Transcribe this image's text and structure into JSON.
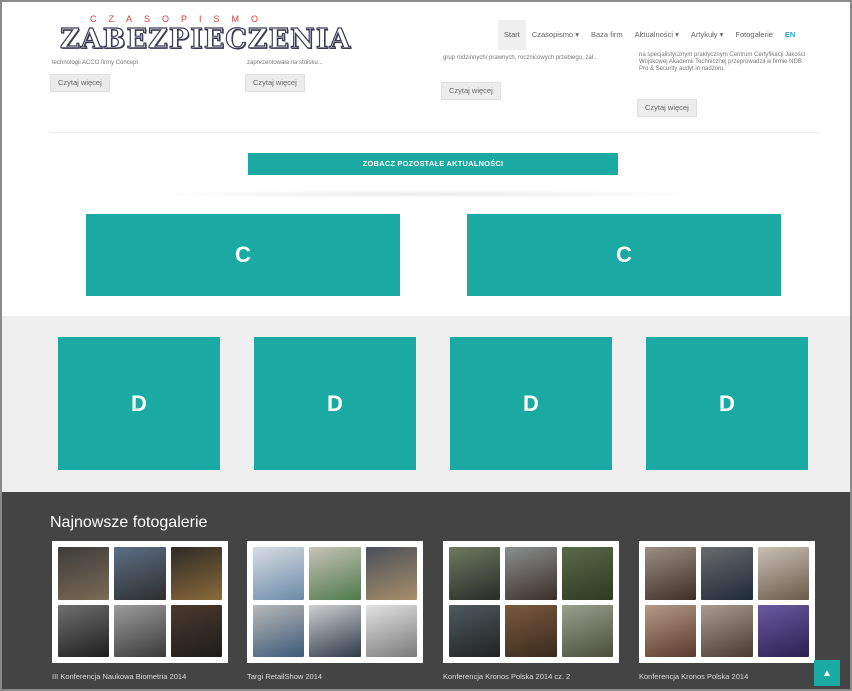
{
  "header": {
    "logo_top": "CZASOPISMO",
    "logo_main": "ZABEZPIECZENIA",
    "nav": [
      {
        "label": "Start"
      },
      {
        "label": "Czasopismo ▾"
      },
      {
        "label": "Baza firm"
      },
      {
        "label": "Aktualności ▾"
      },
      {
        "label": "Artykuły ▾"
      },
      {
        "label": "Fotogalerie"
      },
      {
        "label": "EN"
      }
    ]
  },
  "teasers": [
    {
      "text": "technologii ACCO firmy Concept",
      "button": "Czytaj więcej"
    },
    {
      "text": "zaprezentowała na stoisku...",
      "button": "Czytaj więcej"
    },
    {
      "text": "grup rodzinnych/ prawnych, rocznicowych przebiegu, zał...",
      "button": "Czytaj więcej"
    },
    {
      "text": "na specjalistycznym praktycznym Centrum Certyfikacji Jakości Wojskowej Akademii Technicznej przeprowadził w firmie NDB Pro & Security audyt in nadzoru.",
      "button": "Czytaj więcej"
    }
  ],
  "see_all_button": "ZOBACZ POZOSTAŁE AKTUALNOŚCI",
  "c_blocks": [
    "C",
    "C"
  ],
  "d_blocks": [
    "D",
    "D",
    "D",
    "D"
  ],
  "galleries": {
    "title": "Najnowsze fotogalerie",
    "items": [
      {
        "label": "III Konferencja Naukowa Biometria 2014"
      },
      {
        "label": "Targi RetailShow 2014"
      },
      {
        "label": "Konferencja Kronos Polska 2014 cz. 2"
      },
      {
        "label": "Konferencja Kronos Polska 2014"
      }
    ]
  },
  "scroll_top_icon": "chevron-up-icon",
  "colors": {
    "accent": "#1ba9a3",
    "footer_bg": "#444444",
    "band_bg": "#efefef",
    "lang_link": "#25a4d2",
    "logo_red": "#e23b3b"
  }
}
